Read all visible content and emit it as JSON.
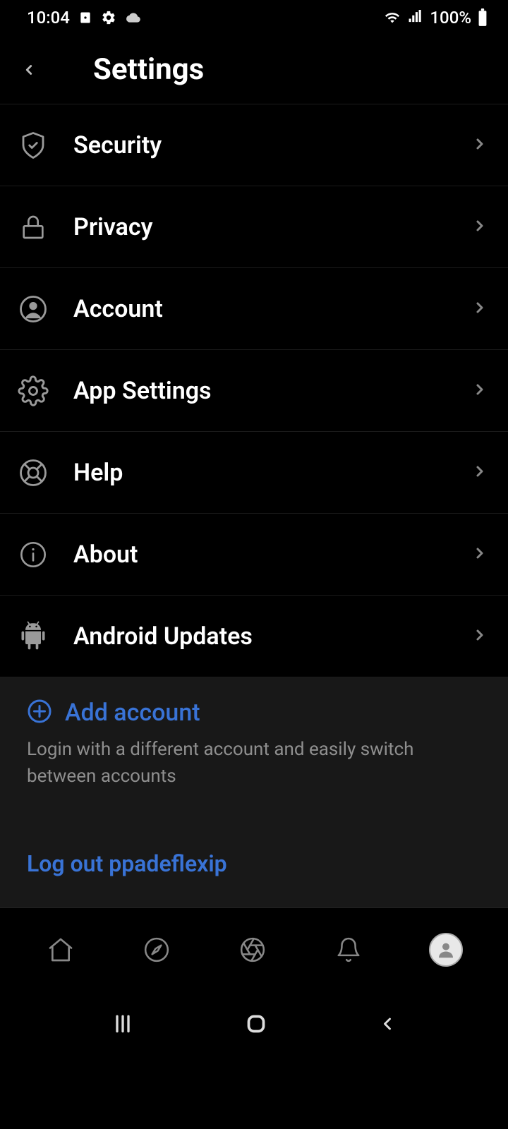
{
  "status": {
    "time": "10:04",
    "battery": "100%"
  },
  "header": {
    "title": "Settings"
  },
  "items": [
    {
      "label": "Security"
    },
    {
      "label": "Privacy"
    },
    {
      "label": "Account"
    },
    {
      "label": "App Settings"
    },
    {
      "label": "Help"
    },
    {
      "label": "About"
    },
    {
      "label": "Android Updates"
    }
  ],
  "addAccount": {
    "label": "Add account",
    "desc": "Login with a different account and easily switch between accounts"
  },
  "logout": {
    "label": "Log out ppadeflexip"
  },
  "colors": {
    "accent": "#3973d6"
  }
}
